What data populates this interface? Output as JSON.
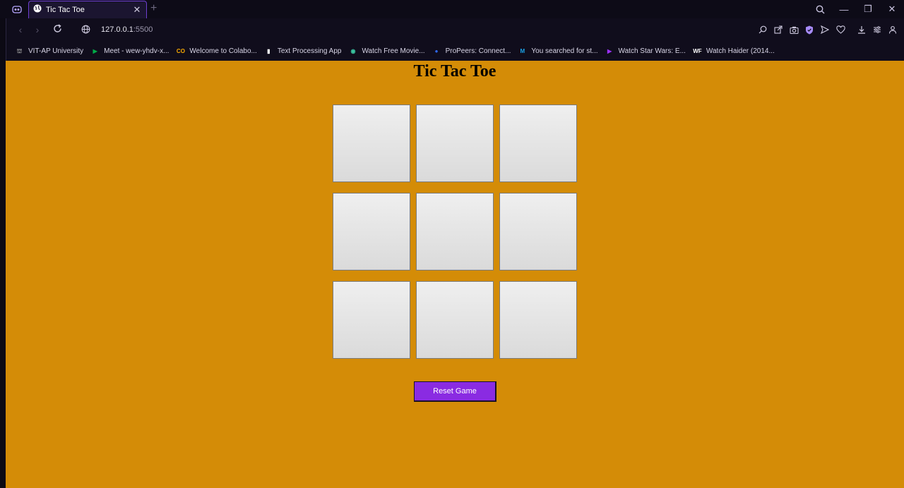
{
  "browser": {
    "tab": {
      "title": "Tic Tac Toe",
      "close": "✕"
    },
    "new_tab": "+",
    "address": {
      "host": "127.0.0.1",
      "port": ":5500"
    },
    "window_controls": {
      "minimize": "—",
      "restore": "❐",
      "close": "✕"
    },
    "bookmarks": [
      {
        "label": "VIT-AP University",
        "icon": "university-icon",
        "color": "#9a9a9a",
        "glyph": "⛫"
      },
      {
        "label": "Meet - wew-yhdv-x...",
        "icon": "google-meet-icon",
        "color": "#00ac47",
        "glyph": "▶"
      },
      {
        "label": "Welcome to Colabo...",
        "icon": "colab-icon",
        "color": "#f9ab00",
        "glyph": "CO"
      },
      {
        "label": "Text Processing App",
        "icon": "document-icon",
        "color": "#ffffff",
        "glyph": "▮"
      },
      {
        "label": "Watch Free Movie...",
        "icon": "movie-site-icon",
        "color": "#3ac6a0",
        "glyph": "◉"
      },
      {
        "label": "ProPeers: Connect...",
        "icon": "propeers-icon",
        "color": "#2f6bff",
        "glyph": "●"
      },
      {
        "label": "You searched for st...",
        "icon": "m-site-icon",
        "color": "#1aa3e8",
        "glyph": "M"
      },
      {
        "label": "Watch Star Wars: E...",
        "icon": "play-icon",
        "color": "#9b30ff",
        "glyph": "▶"
      },
      {
        "label": "Watch Haider (2014...",
        "icon": "wf-site-icon",
        "color": "#ffffff",
        "glyph": "WF"
      }
    ]
  },
  "page": {
    "title": "Tic Tac Toe",
    "board": [
      "",
      "",
      "",
      "",
      "",
      "",
      "",
      "",
      ""
    ],
    "reset_label": "Reset Game"
  },
  "colors": {
    "background": "#d48c07",
    "accent": "#8a2be2",
    "tab_border": "#6e3fd1"
  }
}
